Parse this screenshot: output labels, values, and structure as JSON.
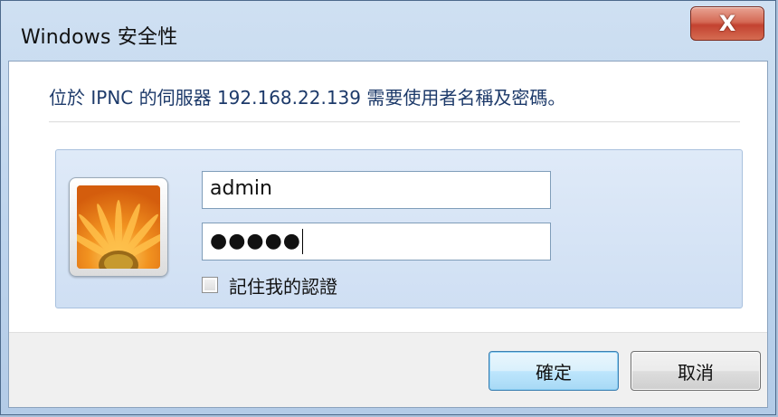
{
  "window": {
    "title": "Windows 安全性",
    "close_label": "X"
  },
  "dialog": {
    "message": "位於 IPNC 的伺服器 192.168.22.139 需要使用者名稱及密碼。",
    "username_value": "admin",
    "password_masked": "●●●●●",
    "remember_label": "記住我的認證",
    "remember_checked": false,
    "avatar_icon": "user-tile-flower-icon"
  },
  "buttons": {
    "ok_label": "確定",
    "cancel_label": "取消"
  },
  "colors": {
    "title_bar": "#bcd3ec",
    "message_text": "#1d3a6a",
    "panel_bg": "#dfeaf8",
    "close_button": "#c34230",
    "ok_border": "#3c7fb1"
  }
}
